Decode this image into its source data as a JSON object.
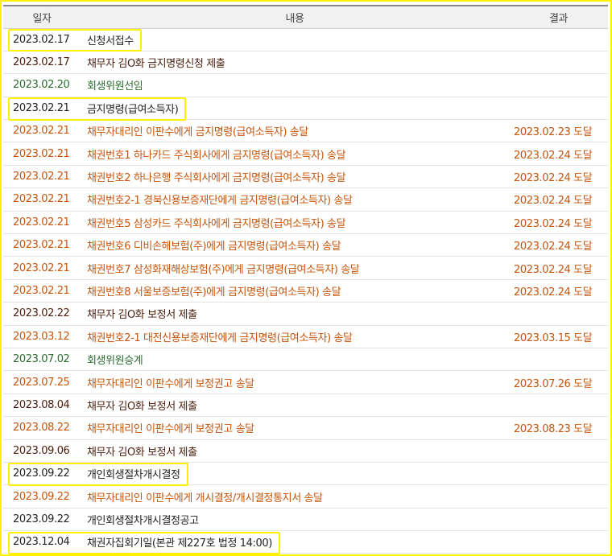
{
  "colors": {
    "frame_highlight": "#fff200",
    "orange": "#c6540c",
    "dark": "#4a1c0c",
    "green": "#2d6b31",
    "black": "#222222"
  },
  "table": {
    "headers": {
      "date": "일자",
      "content": "내용",
      "result": "결과"
    },
    "rows": [
      {
        "date": "2023.02.17",
        "content": "신청서접수",
        "result": "",
        "tone": "black",
        "highlight": true
      },
      {
        "date": "2023.02.17",
        "content": "채무자 김O화 금지명령신청 제출",
        "result": "",
        "tone": "dark",
        "highlight": false
      },
      {
        "date": "2023.02.20",
        "content": "회생위원선임",
        "result": "",
        "tone": "green",
        "highlight": false
      },
      {
        "date": "2023.02.21",
        "content": "금지명령(급여소득자)",
        "result": "",
        "tone": "black",
        "highlight": true
      },
      {
        "date": "2023.02.21",
        "content": "채무자대리인 이판수에게 금지명령(급여소득자) 송달",
        "result": "2023.02.23 도달",
        "tone": "orange",
        "highlight": false
      },
      {
        "date": "2023.02.21",
        "content": "채권번호1 하나카드 주식회사에게 금지명령(급여소득자) 송달",
        "result": "2023.02.24 도달",
        "tone": "orange",
        "highlight": false
      },
      {
        "date": "2023.02.21",
        "content": "채권번호2 하나은행 주식회사에게 금지명령(급여소득자) 송달",
        "result": "2023.02.24 도달",
        "tone": "orange",
        "highlight": false
      },
      {
        "date": "2023.02.21",
        "content": "채권번호2-1 경북신용보증재단에게 금지명령(급여소득자) 송달",
        "result": "2023.02.24 도달",
        "tone": "orange",
        "highlight": false
      },
      {
        "date": "2023.02.21",
        "content": "채권번호5 삼성카드 주식회사에게 금지명령(급여소득자) 송달",
        "result": "2023.02.24 도달",
        "tone": "orange",
        "highlight": false
      },
      {
        "date": "2023.02.21",
        "content": "채권번호6 디비손해보험(주)에게 금지명령(급여소득자) 송달",
        "result": "2023.02.24 도달",
        "tone": "orange",
        "highlight": false
      },
      {
        "date": "2023.02.21",
        "content": "채권번호7 삼성화재해상보험(주)에게 금지명령(급여소득자) 송달",
        "result": "2023.02.24 도달",
        "tone": "orange",
        "highlight": false
      },
      {
        "date": "2023.02.21",
        "content": "채권번호8 서울보증보험(주)에게 금지명령(급여소득자) 송달",
        "result": "2023.02.24 도달",
        "tone": "orange",
        "highlight": false
      },
      {
        "date": "2023.02.22",
        "content": "채무자 김O화 보정서 제출",
        "result": "",
        "tone": "dark",
        "highlight": false
      },
      {
        "date": "2023.03.12",
        "content": "채권번호2-1 대전신용보증재단에게 금지명령(급여소득자) 송달",
        "result": "2023.03.15 도달",
        "tone": "orange",
        "highlight": false
      },
      {
        "date": "2023.07.02",
        "content": "회생위원승계",
        "result": "",
        "tone": "green",
        "highlight": false
      },
      {
        "date": "2023.07.25",
        "content": "채무자대리인 이판수에게 보정권고 송달",
        "result": "2023.07.26 도달",
        "tone": "orange",
        "highlight": false
      },
      {
        "date": "2023.08.04",
        "content": "채무자 김O화 보정서 제출",
        "result": "",
        "tone": "dark",
        "highlight": false
      },
      {
        "date": "2023.08.22",
        "content": "채무자대리인 이판수에게 보정권고 송달",
        "result": "2023.08.23 도달",
        "tone": "orange",
        "highlight": false
      },
      {
        "date": "2023.09.06",
        "content": "채무자 김O화 보정서 제출",
        "result": "",
        "tone": "dark",
        "highlight": false
      },
      {
        "date": "2023.09.22",
        "content": "개인회생절차개시결정",
        "result": "",
        "tone": "black",
        "highlight": true
      },
      {
        "date": "2023.09.22",
        "content": "채무자대리인 이판수에게 개시결정/개시결정통지서 송달",
        "result": "",
        "tone": "orange",
        "highlight": false
      },
      {
        "date": "2023.09.22",
        "content": "개인회생절차개시결정공고",
        "result": "",
        "tone": "black",
        "highlight": false
      },
      {
        "date": "2023.12.04",
        "content": "채권자집회기일(본관 제227호 법정 14:00)",
        "result": "",
        "tone": "black",
        "highlight": true
      }
    ]
  }
}
